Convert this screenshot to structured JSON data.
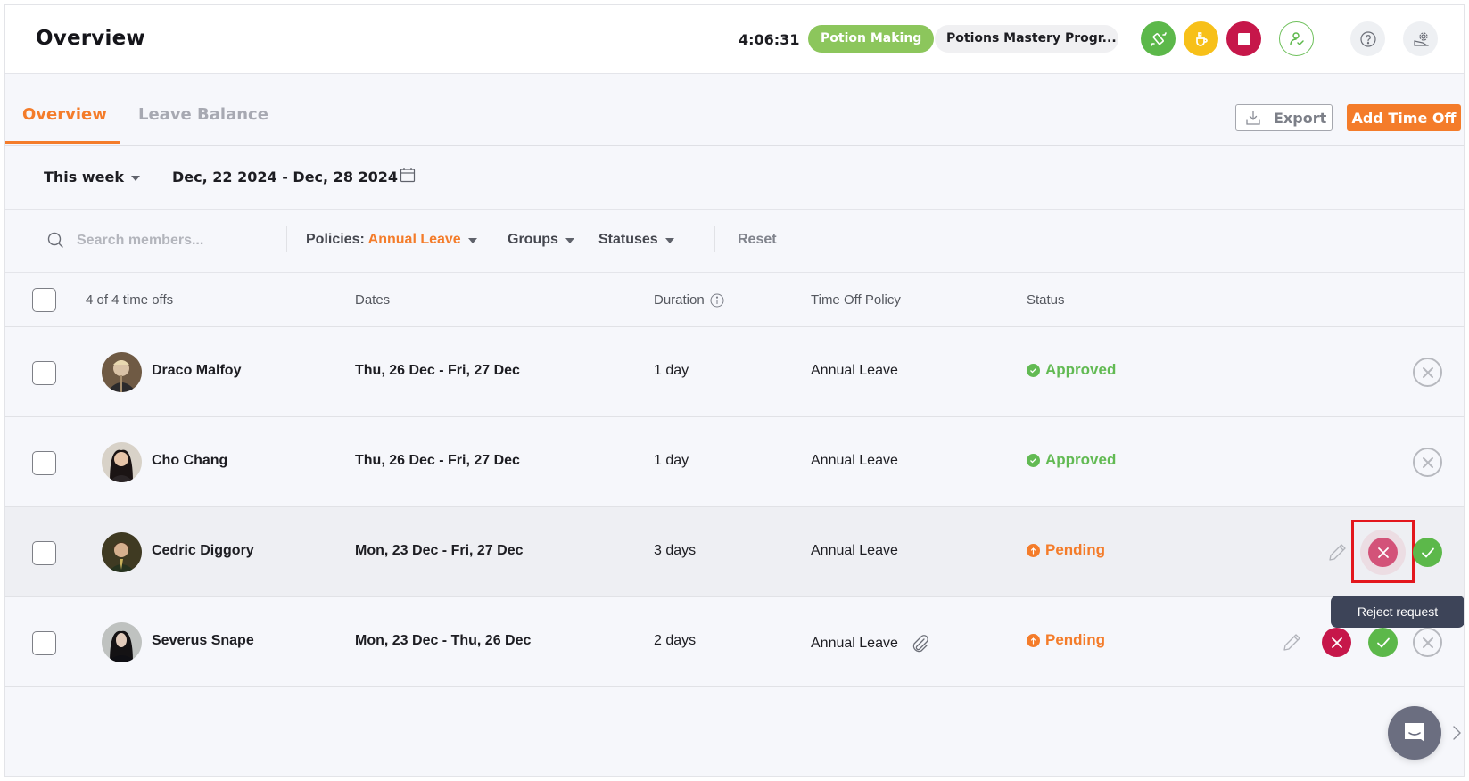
{
  "header": {
    "title": "Overview",
    "timer": "4:06:31",
    "project_pill": "Potion Making",
    "task_pill": "Potions Mastery Progr...",
    "icons": {
      "switch": "switch-task-icon",
      "break": "coffee-break-icon",
      "stop": "stop-timer-icon",
      "attendance": "attendance-icon",
      "help": "help-icon",
      "settings": "settings-icon"
    }
  },
  "tabs": [
    {
      "label": "Overview",
      "active": true
    },
    {
      "label": "Leave Balance",
      "active": false
    }
  ],
  "actions": {
    "export_label": "Export",
    "add_label": "Add Time Off"
  },
  "date_filter": {
    "range_preset": "This week",
    "range_text": "Dec, 22 2024 - Dec, 28 2024"
  },
  "filters": {
    "search_placeholder": "Search members...",
    "policies_label": "Policies",
    "policies_value": "Annual Leave",
    "groups_label": "Groups",
    "statuses_label": "Statuses",
    "reset_label": "Reset"
  },
  "table": {
    "count_label": "4 of 4 time offs",
    "columns": [
      "Dates",
      "Duration",
      "Time Off Policy",
      "Status"
    ],
    "rows": [
      {
        "name": "Draco Malfoy",
        "dates": "Thu, 26 Dec - Fri, 27 Dec",
        "duration": "1 day",
        "policy": "Annual Leave",
        "status": "Approved",
        "attachment": false
      },
      {
        "name": "Cho Chang",
        "dates": "Thu, 26 Dec - Fri, 27 Dec",
        "duration": "1 day",
        "policy": "Annual Leave",
        "status": "Approved",
        "attachment": false
      },
      {
        "name": "Cedric Diggory",
        "dates": "Mon, 23 Dec - Fri, 27 Dec",
        "duration": "3 days",
        "policy": "Annual Leave",
        "status": "Pending",
        "attachment": false
      },
      {
        "name": "Severus Snape",
        "dates": "Mon, 23 Dec - Thu, 26 Dec",
        "duration": "2 days",
        "policy": "Annual Leave",
        "status": "Pending",
        "attachment": true
      }
    ]
  },
  "tooltip": "Reject request",
  "colors": {
    "accent": "#f47c2a",
    "approved": "#62ba53",
    "pending": "#f47c2a",
    "reject": "#c6174a",
    "project_pill": "#8cc65c"
  }
}
